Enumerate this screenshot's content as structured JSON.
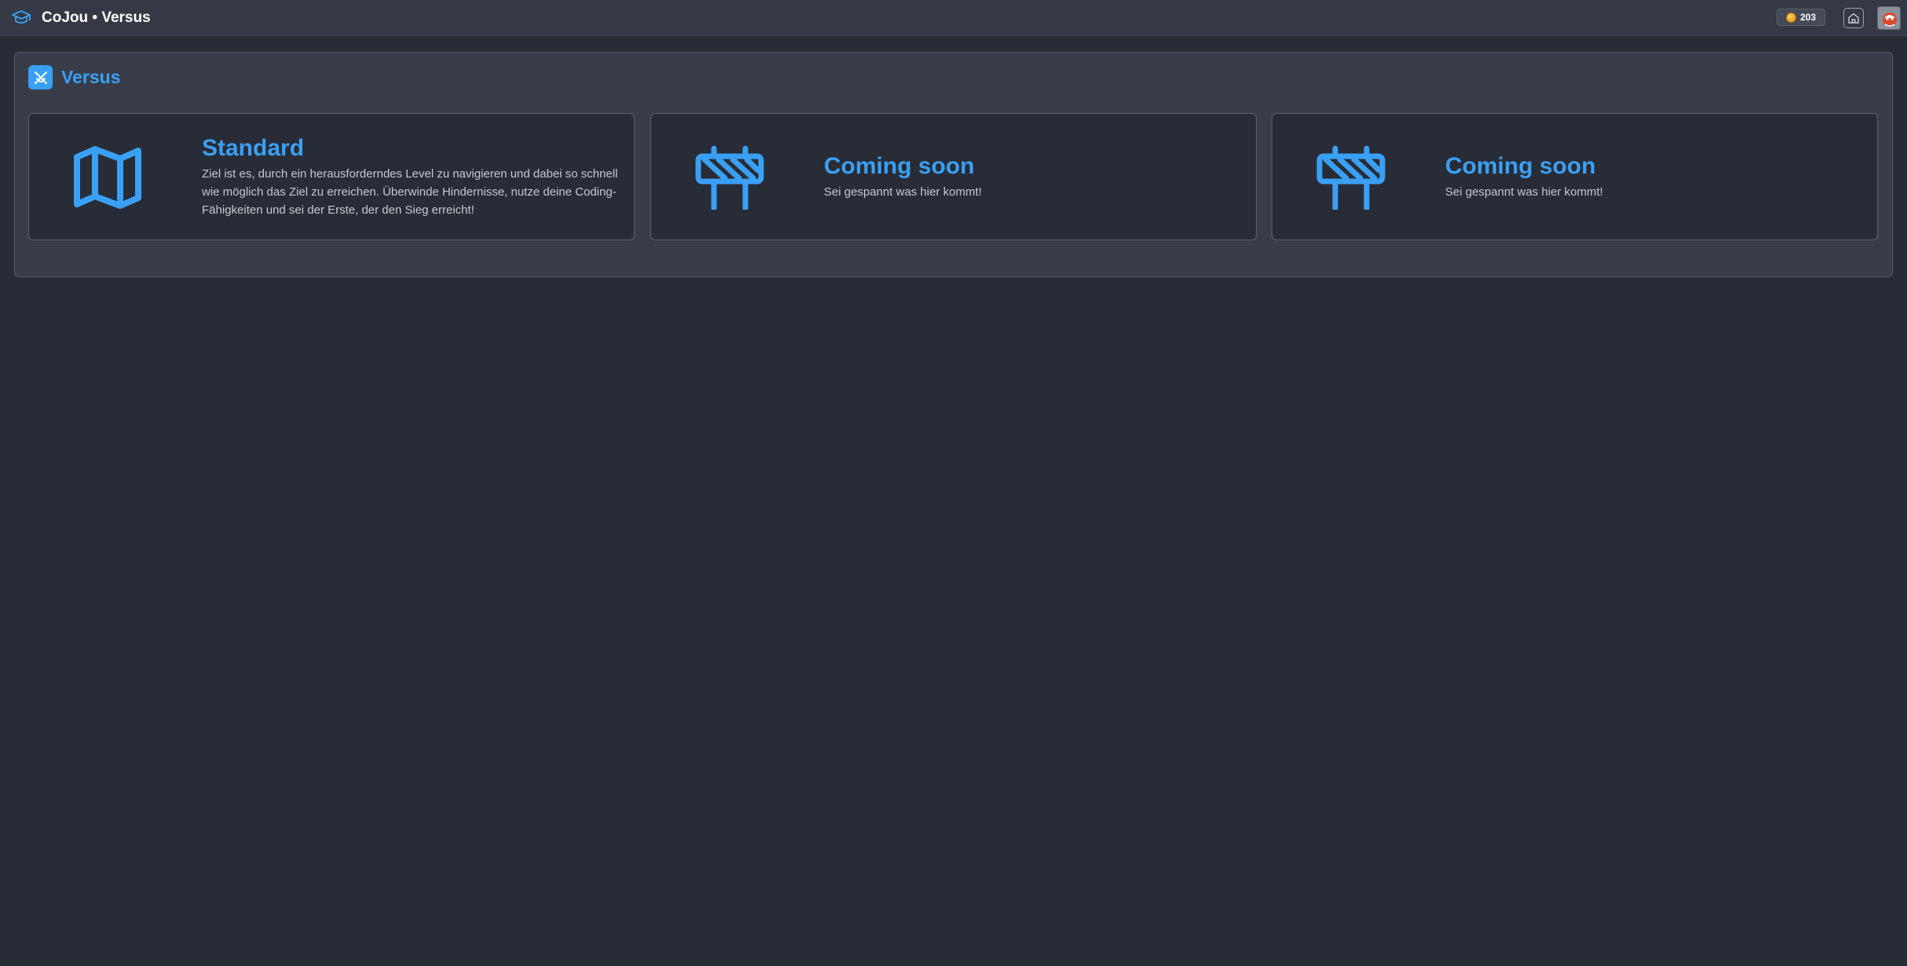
{
  "header": {
    "title": "CoJou • Versus",
    "coins": "203",
    "logo_icon": "graduation-cap-icon",
    "home_icon": "home-icon",
    "avatar_icon": "user-avatar"
  },
  "panel": {
    "title": "Versus",
    "icon": "swords-icon"
  },
  "cards": [
    {
      "icon": "map-icon",
      "title": "Standard",
      "description": "Ziel ist es, durch ein herausforderndes Level zu navigieren und dabei so schnell wie möglich das Ziel zu erreichen. Überwinde Hindernisse, nutze deine Coding-Fähigkeiten und sei der Erste, der den Sieg erreicht!"
    },
    {
      "icon": "barrier-icon",
      "title": "Coming soon",
      "description": "Sei gespannt was hier kommt!"
    },
    {
      "icon": "barrier-icon",
      "title": "Coming soon",
      "description": "Sei gespannt was hier kommt!"
    }
  ],
  "colors": {
    "accent": "#3aa0f5",
    "background": "#282c36",
    "panel": "#393d49",
    "topbar": "#353945"
  }
}
